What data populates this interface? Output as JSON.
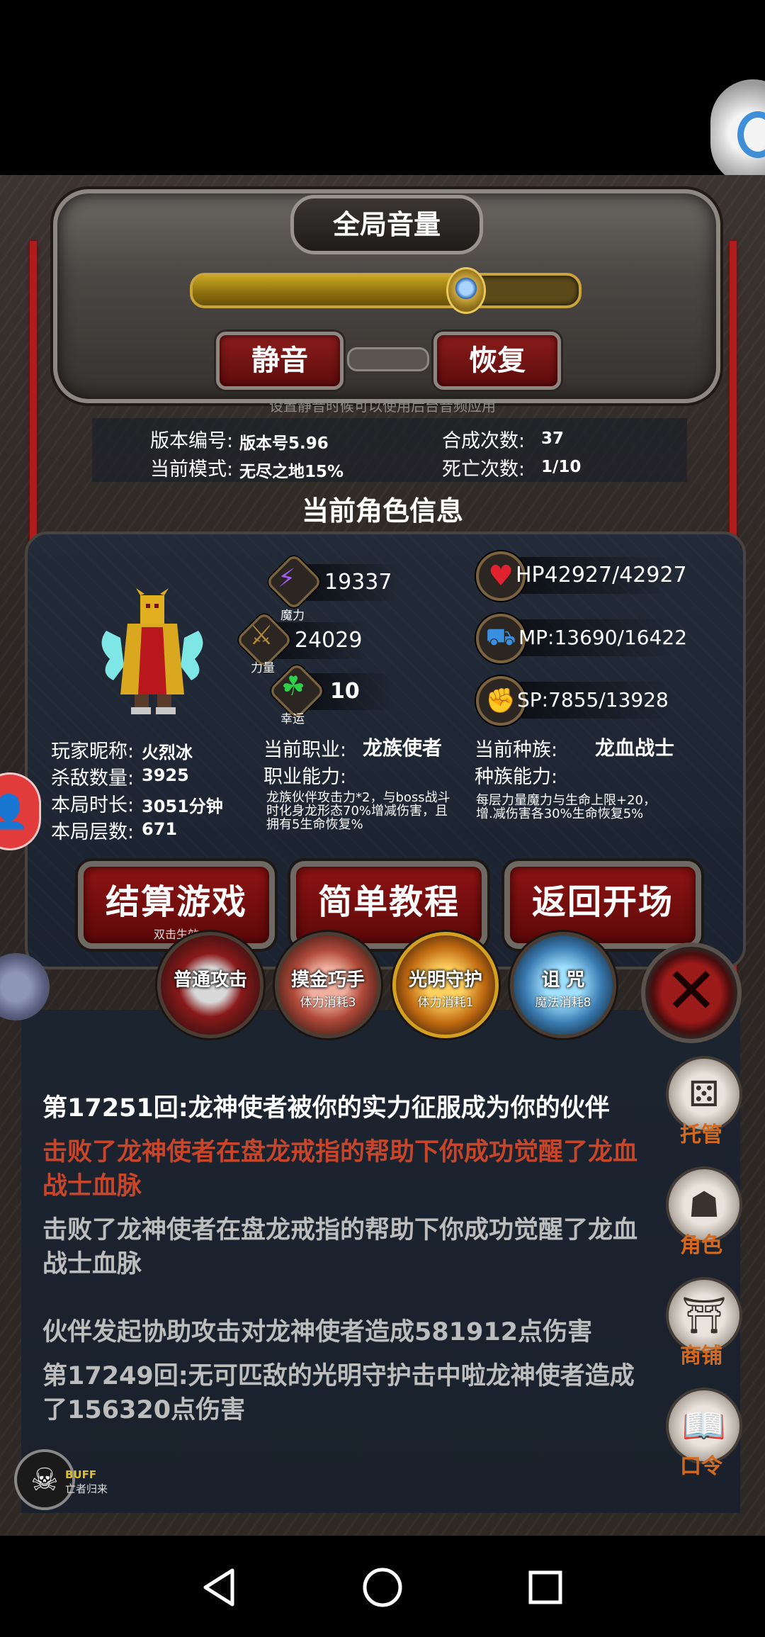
{
  "volume": {
    "title": "全局音量",
    "level_percent": 70,
    "mute_label": "静音",
    "restore_label": "恢复",
    "hint": "设置静音时候可以使用后台音频应用"
  },
  "game_info": {
    "version_label": "版本编号:",
    "version_value": "版本号5.96",
    "mode_label": "当前模式:",
    "mode_value": "无尽之地15%",
    "craft_label": "合成次数:",
    "craft_value": "37",
    "death_label": "死亡次数:",
    "death_value": "1/10"
  },
  "character": {
    "section_title": "当前角色信息",
    "stats": {
      "magic_value": "19337",
      "magic_caption": "魔力",
      "strength_value": "24029",
      "strength_caption": "力量",
      "luck_value": "10",
      "luck_caption": "幸运",
      "hp": "HP42927/42927",
      "mp": "MP:13690/16422",
      "sp": "SP:7855/13928"
    },
    "nickname_label": "玩家昵称:",
    "nickname_value": "火烈冰",
    "kills_label": "杀敌数量:",
    "kills_value": "3925",
    "duration_label": "本局时长:",
    "duration_value": "3051分钟",
    "floor_label": "本局层数:",
    "floor_value": "671",
    "job_label": "当前职业:",
    "job_value": "龙族使者",
    "job_ability_label": "职业能力:",
    "job_ability_desc": "龙族伙伴攻击力*2，与boss战斗时化身龙形态70%增减伤害，且拥有5生命恢复%",
    "race_label": "当前种族:",
    "race_value": "龙血战士",
    "race_ability_label": "种族能力:",
    "race_ability_desc": "每层力量魔力与生命上限+20，增.减伤害各30%生命恢复5%"
  },
  "actions": {
    "settle": "结算游戏",
    "settle_sub": "双击生效",
    "tutorial": "简单教程",
    "back": "返回开场"
  },
  "skills": [
    {
      "name": "普通攻击",
      "cost": ""
    },
    {
      "name": "摸金巧手",
      "cost": "体力消耗3"
    },
    {
      "name": "光明守护",
      "cost": "体力消耗1"
    },
    {
      "name": "诅 咒",
      "cost": "魔法消耗8"
    }
  ],
  "log": [
    {
      "text": "第17251回:龙神使者被你的实力征服成为你的伙伴",
      "color": "#ffffff"
    },
    {
      "text": "击败了龙神使者在盘龙戒指的帮助下你成功觉醒了龙血战士血脉",
      "color": "#c9452a"
    },
    {
      "text": "击败了龙神使者在盘龙戒指的帮助下你成功觉醒了龙血战士血脉",
      "color": "#bdbdbd"
    },
    {
      "text": "伙伴发起协助攻击对龙神使者造成581912点伤害",
      "color": "#bdbdbd"
    },
    {
      "text": "第17249回:无可匹敌的光明守护击中啦龙神使者造成了156320点伤害",
      "color": "#bdbdbd"
    }
  ],
  "side_menu": {
    "auto": "托管",
    "role": "角色",
    "shop": "商铺",
    "code": "口令"
  },
  "buff": {
    "label": "BUFF",
    "sub": "亡者归来"
  },
  "colors": {
    "gold": "#c8a521",
    "button_red": "#8f1414",
    "side_label": "#d2691e",
    "hp_heart": "#e0232e"
  }
}
